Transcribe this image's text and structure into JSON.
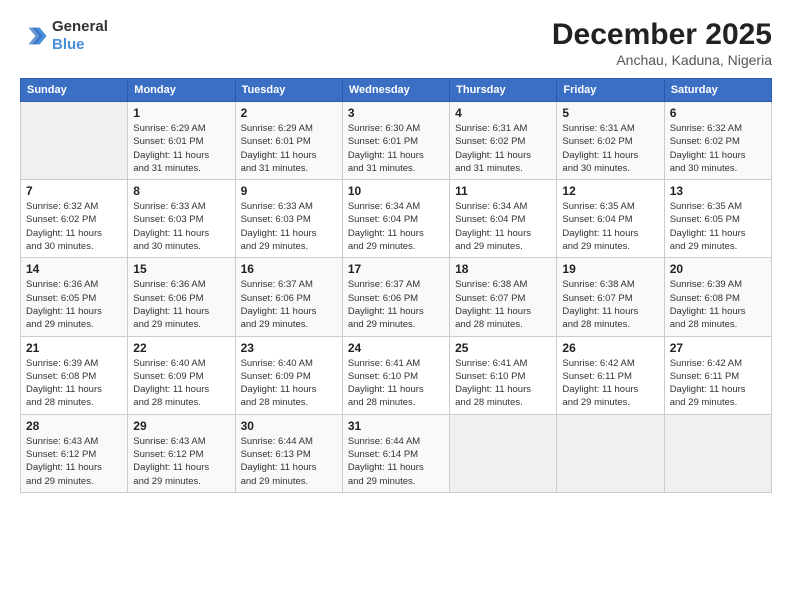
{
  "header": {
    "logo_general": "General",
    "logo_blue": "Blue",
    "title": "December 2025",
    "subtitle": "Anchau, Kaduna, Nigeria"
  },
  "calendar": {
    "columns": [
      "Sunday",
      "Monday",
      "Tuesday",
      "Wednesday",
      "Thursday",
      "Friday",
      "Saturday"
    ],
    "rows": [
      [
        {
          "day": "",
          "info": ""
        },
        {
          "day": "1",
          "info": "Sunrise: 6:29 AM\nSunset: 6:01 PM\nDaylight: 11 hours\nand 31 minutes."
        },
        {
          "day": "2",
          "info": "Sunrise: 6:29 AM\nSunset: 6:01 PM\nDaylight: 11 hours\nand 31 minutes."
        },
        {
          "day": "3",
          "info": "Sunrise: 6:30 AM\nSunset: 6:01 PM\nDaylight: 11 hours\nand 31 minutes."
        },
        {
          "day": "4",
          "info": "Sunrise: 6:31 AM\nSunset: 6:02 PM\nDaylight: 11 hours\nand 31 minutes."
        },
        {
          "day": "5",
          "info": "Sunrise: 6:31 AM\nSunset: 6:02 PM\nDaylight: 11 hours\nand 30 minutes."
        },
        {
          "day": "6",
          "info": "Sunrise: 6:32 AM\nSunset: 6:02 PM\nDaylight: 11 hours\nand 30 minutes."
        }
      ],
      [
        {
          "day": "7",
          "info": "Sunrise: 6:32 AM\nSunset: 6:02 PM\nDaylight: 11 hours\nand 30 minutes."
        },
        {
          "day": "8",
          "info": "Sunrise: 6:33 AM\nSunset: 6:03 PM\nDaylight: 11 hours\nand 30 minutes."
        },
        {
          "day": "9",
          "info": "Sunrise: 6:33 AM\nSunset: 6:03 PM\nDaylight: 11 hours\nand 29 minutes."
        },
        {
          "day": "10",
          "info": "Sunrise: 6:34 AM\nSunset: 6:04 PM\nDaylight: 11 hours\nand 29 minutes."
        },
        {
          "day": "11",
          "info": "Sunrise: 6:34 AM\nSunset: 6:04 PM\nDaylight: 11 hours\nand 29 minutes."
        },
        {
          "day": "12",
          "info": "Sunrise: 6:35 AM\nSunset: 6:04 PM\nDaylight: 11 hours\nand 29 minutes."
        },
        {
          "day": "13",
          "info": "Sunrise: 6:35 AM\nSunset: 6:05 PM\nDaylight: 11 hours\nand 29 minutes."
        }
      ],
      [
        {
          "day": "14",
          "info": "Sunrise: 6:36 AM\nSunset: 6:05 PM\nDaylight: 11 hours\nand 29 minutes."
        },
        {
          "day": "15",
          "info": "Sunrise: 6:36 AM\nSunset: 6:06 PM\nDaylight: 11 hours\nand 29 minutes."
        },
        {
          "day": "16",
          "info": "Sunrise: 6:37 AM\nSunset: 6:06 PM\nDaylight: 11 hours\nand 29 minutes."
        },
        {
          "day": "17",
          "info": "Sunrise: 6:37 AM\nSunset: 6:06 PM\nDaylight: 11 hours\nand 29 minutes."
        },
        {
          "day": "18",
          "info": "Sunrise: 6:38 AM\nSunset: 6:07 PM\nDaylight: 11 hours\nand 28 minutes."
        },
        {
          "day": "19",
          "info": "Sunrise: 6:38 AM\nSunset: 6:07 PM\nDaylight: 11 hours\nand 28 minutes."
        },
        {
          "day": "20",
          "info": "Sunrise: 6:39 AM\nSunset: 6:08 PM\nDaylight: 11 hours\nand 28 minutes."
        }
      ],
      [
        {
          "day": "21",
          "info": "Sunrise: 6:39 AM\nSunset: 6:08 PM\nDaylight: 11 hours\nand 28 minutes."
        },
        {
          "day": "22",
          "info": "Sunrise: 6:40 AM\nSunset: 6:09 PM\nDaylight: 11 hours\nand 28 minutes."
        },
        {
          "day": "23",
          "info": "Sunrise: 6:40 AM\nSunset: 6:09 PM\nDaylight: 11 hours\nand 28 minutes."
        },
        {
          "day": "24",
          "info": "Sunrise: 6:41 AM\nSunset: 6:10 PM\nDaylight: 11 hours\nand 28 minutes."
        },
        {
          "day": "25",
          "info": "Sunrise: 6:41 AM\nSunset: 6:10 PM\nDaylight: 11 hours\nand 28 minutes."
        },
        {
          "day": "26",
          "info": "Sunrise: 6:42 AM\nSunset: 6:11 PM\nDaylight: 11 hours\nand 29 minutes."
        },
        {
          "day": "27",
          "info": "Sunrise: 6:42 AM\nSunset: 6:11 PM\nDaylight: 11 hours\nand 29 minutes."
        }
      ],
      [
        {
          "day": "28",
          "info": "Sunrise: 6:43 AM\nSunset: 6:12 PM\nDaylight: 11 hours\nand 29 minutes."
        },
        {
          "day": "29",
          "info": "Sunrise: 6:43 AM\nSunset: 6:12 PM\nDaylight: 11 hours\nand 29 minutes."
        },
        {
          "day": "30",
          "info": "Sunrise: 6:44 AM\nSunset: 6:13 PM\nDaylight: 11 hours\nand 29 minutes."
        },
        {
          "day": "31",
          "info": "Sunrise: 6:44 AM\nSunset: 6:14 PM\nDaylight: 11 hours\nand 29 minutes."
        },
        {
          "day": "",
          "info": ""
        },
        {
          "day": "",
          "info": ""
        },
        {
          "day": "",
          "info": ""
        }
      ]
    ]
  }
}
